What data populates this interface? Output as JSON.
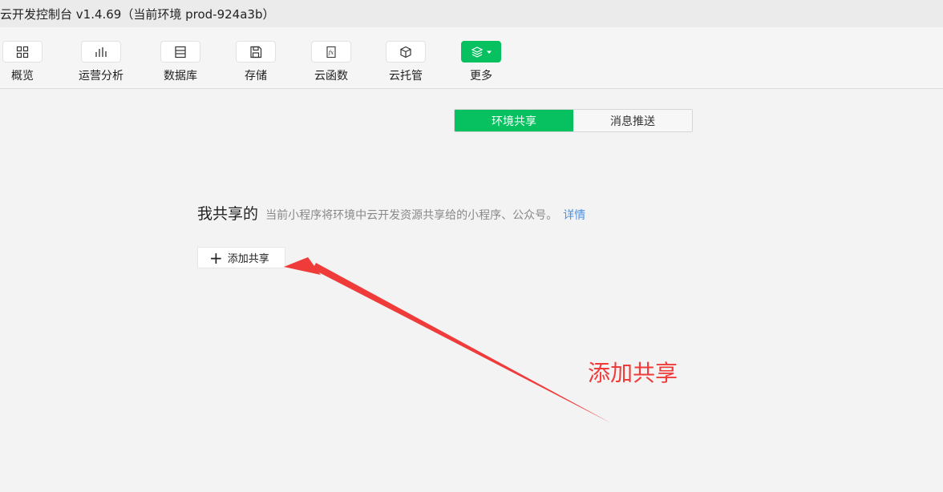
{
  "window": {
    "title": "云开发控制台 v1.4.69（当前环境 prod-924a3b）"
  },
  "toolbar": {
    "items": [
      {
        "label": "概览",
        "icon": "grid-icon"
      },
      {
        "label": "运营分析",
        "icon": "bar-chart-icon"
      },
      {
        "label": "数据库",
        "icon": "database-icon"
      },
      {
        "label": "存储",
        "icon": "save-icon"
      },
      {
        "label": "云函数",
        "icon": "function-icon"
      },
      {
        "label": "云托管",
        "icon": "cube-icon"
      },
      {
        "label": "更多",
        "icon": "layers-icon"
      }
    ]
  },
  "tabs": [
    {
      "label": "环境共享",
      "active": true
    },
    {
      "label": "消息推送",
      "active": false
    }
  ],
  "section": {
    "title": "我共享的",
    "description": "当前小程序将环境中云开发资源共享给的小程序、公众号。",
    "link": "详情",
    "add_button": "添加共享"
  },
  "annotation": {
    "text": "添加共享",
    "color": "#f03b3b"
  },
  "colors": {
    "accent": "#07c160",
    "link": "#4a90e2"
  }
}
